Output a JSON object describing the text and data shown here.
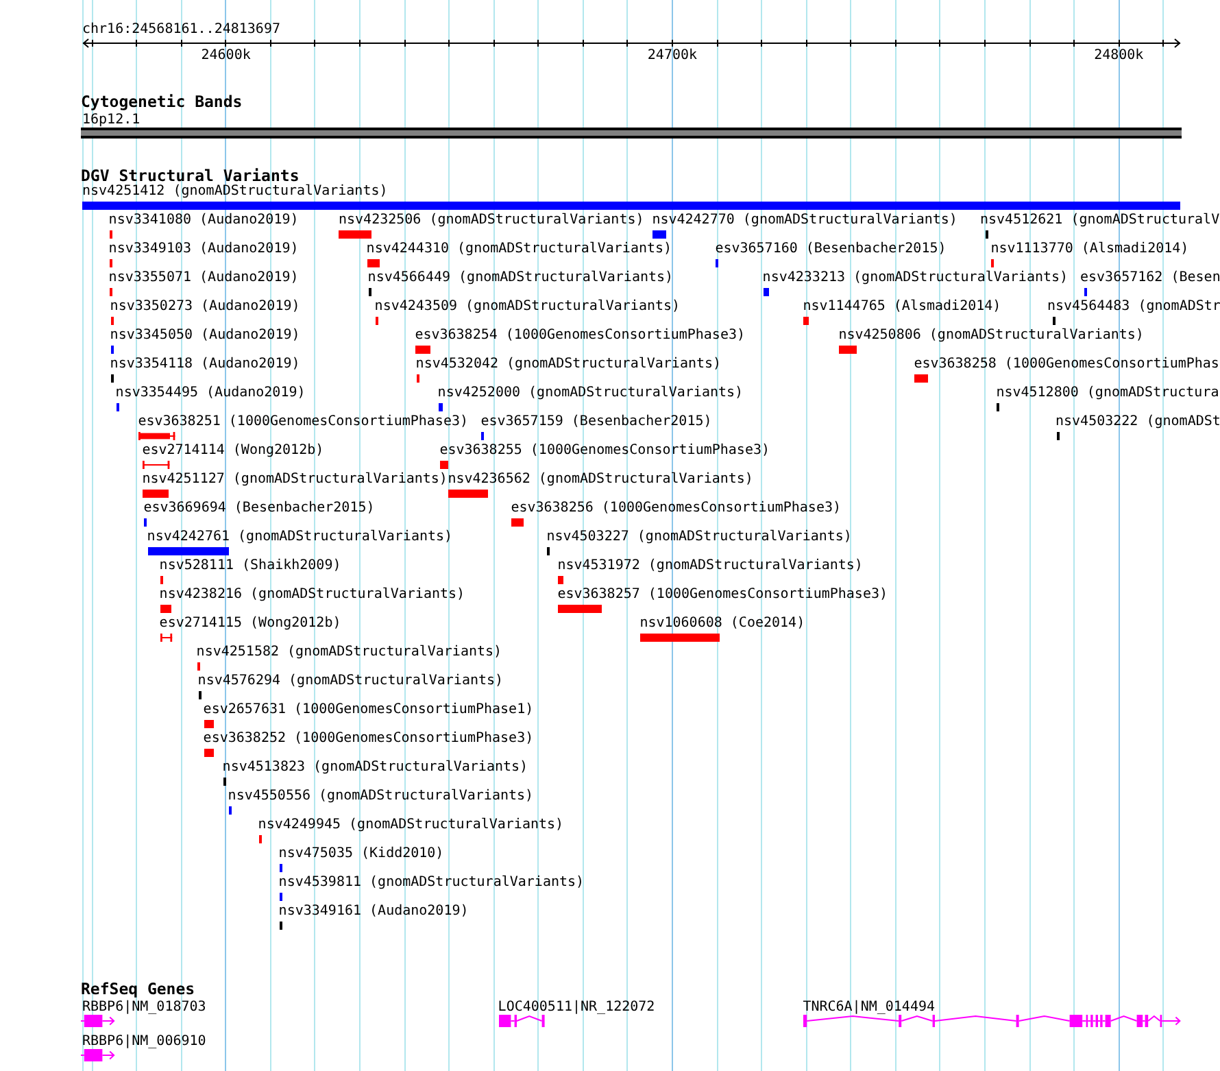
{
  "ruler": {
    "location": "chr16:24568161..24813697",
    "ticks": [
      "24600k",
      "24700k",
      "24800k"
    ]
  },
  "tracks": [
    {
      "kind": "cytoband",
      "title": "Cytogenetic Bands",
      "features": [
        {
          "label": "16p12.1"
        }
      ]
    },
    {
      "kind": "variants",
      "title": "DGV Structural Variants",
      "features": [
        {
          "label": "nsv4251412 (gnomADStructuralVariants)",
          "color": "#0000ff",
          "kind": "bar"
        },
        {
          "label": "nsv3341080 (Audano2019)",
          "color": "#ff0000",
          "kind": "bar"
        },
        {
          "label": "nsv4232506 (gnomADStructuralVariants)",
          "color": "#ff0000",
          "kind": "bar"
        },
        {
          "label": "nsv4242770 (gnomADStructuralVariants)",
          "color": "#0000ff",
          "kind": "bar"
        },
        {
          "label": "nsv4512621 (gnomADStructuralV",
          "color": "#000000",
          "kind": "bar"
        },
        {
          "label": "nsv3349103 (Audano2019)",
          "color": "#ff0000",
          "kind": "bar"
        },
        {
          "label": "nsv4244310 (gnomADStructuralVariants)",
          "color": "#ff0000",
          "kind": "bar"
        },
        {
          "label": "esv3657160 (Besenbacher2015)",
          "color": "#0000ff",
          "kind": "bar"
        },
        {
          "label": "nsv1113770 (Alsmadi2014)",
          "color": "#ff0000",
          "kind": "bar"
        },
        {
          "label": "nsv3355071 (Audano2019)",
          "color": "#ff0000",
          "kind": "bar"
        },
        {
          "label": "nsv4566449 (gnomADStructuralVariants)",
          "color": "#000000",
          "kind": "bar"
        },
        {
          "label": "nsv4233213 (gnomADStructuralVariants)",
          "color": "#0000ff",
          "kind": "bar"
        },
        {
          "label": "esv3657162 (Besen",
          "color": "#0000ff",
          "kind": "bar"
        },
        {
          "label": "nsv3350273 (Audano2019)",
          "color": "#ff0000",
          "kind": "bar"
        },
        {
          "label": "nsv4243509 (gnomADStructuralVariants)",
          "color": "#ff0000",
          "kind": "bar"
        },
        {
          "label": "nsv1144765 (Alsmadi2014)",
          "color": "#ff0000",
          "kind": "bar"
        },
        {
          "label": "nsv4564483 (gnomADStr",
          "color": "#000000",
          "kind": "bar"
        },
        {
          "label": "nsv3345050 (Audano2019)",
          "color": "#0000ff",
          "kind": "bar"
        },
        {
          "label": "esv3638254 (1000GenomesConsortiumPhase3)",
          "color": "#ff0000",
          "kind": "bar"
        },
        {
          "label": "nsv4250806 (gnomADStructuralVariants)",
          "color": "#ff0000",
          "kind": "bar"
        },
        {
          "label": "nsv3354118 (Audano2019)",
          "color": "#000000",
          "kind": "bar"
        },
        {
          "label": "nsv4532042 (gnomADStructuralVariants)",
          "color": "#ff0000",
          "kind": "bar"
        },
        {
          "label": "esv3638258 (1000GenomesConsortiumPhas",
          "color": "#ff0000",
          "kind": "bar"
        },
        {
          "label": "nsv3354495 (Audano2019)",
          "color": "#0000ff",
          "kind": "bar"
        },
        {
          "label": "nsv4252000 (gnomADStructuralVariants)",
          "color": "#0000ff",
          "kind": "bar"
        },
        {
          "label": "nsv4512800 (gnomADStructura",
          "color": "#000000",
          "kind": "bar"
        },
        {
          "label": "esv3638251 (1000GenomesConsortiumPhase3)",
          "color": "#ff0000",
          "kind": "interval"
        },
        {
          "label": "esv3657159 (Besenbacher2015)",
          "color": "#0000ff",
          "kind": "bar"
        },
        {
          "label": "nsv4503222 (gnomADSt",
          "color": "#000000",
          "kind": "bar"
        },
        {
          "label": "esv2714114 (Wong2012b)",
          "color": "#ff0000",
          "kind": "interval"
        },
        {
          "label": "esv3638255 (1000GenomesConsortiumPhase3)",
          "color": "#ff0000",
          "kind": "bar"
        },
        {
          "label": "nsv4251127 (gnomADStructuralVariants)",
          "color": "#ff0000",
          "kind": "bar"
        },
        {
          "label": "nsv4236562 (gnomADStructuralVariants)",
          "color": "#ff0000",
          "kind": "bar"
        },
        {
          "label": "esv3669694 (Besenbacher2015)",
          "color": "#0000ff",
          "kind": "bar"
        },
        {
          "label": "esv3638256 (1000GenomesConsortiumPhase3)",
          "color": "#ff0000",
          "kind": "bar"
        },
        {
          "label": "nsv4242761 (gnomADStructuralVariants)",
          "color": "#0000ff",
          "kind": "bar"
        },
        {
          "label": "nsv4503227 (gnomADStructuralVariants)",
          "color": "#000000",
          "kind": "bar"
        },
        {
          "label": "nsv528111 (Shaikh2009)",
          "color": "#ff0000",
          "kind": "bar"
        },
        {
          "label": "nsv4531972 (gnomADStructuralVariants)",
          "color": "#ff0000",
          "kind": "bar"
        },
        {
          "label": "nsv4238216 (gnomADStructuralVariants)",
          "color": "#ff0000",
          "kind": "bar"
        },
        {
          "label": "esv3638257 (1000GenomesConsortiumPhase3)",
          "color": "#ff0000",
          "kind": "bar"
        },
        {
          "label": "esv2714115 (Wong2012b)",
          "color": "#ff0000",
          "kind": "interval"
        },
        {
          "label": "nsv1060608 (Coe2014)",
          "color": "#ff0000",
          "kind": "bar"
        },
        {
          "label": "nsv4251582 (gnomADStructuralVariants)",
          "color": "#ff0000",
          "kind": "bar"
        },
        {
          "label": "nsv4576294 (gnomADStructuralVariants)",
          "color": "#000000",
          "kind": "bar"
        },
        {
          "label": "esv2657631 (1000GenomesConsortiumPhase1)",
          "color": "#ff0000",
          "kind": "bar"
        },
        {
          "label": "esv3638252 (1000GenomesConsortiumPhase3)",
          "color": "#ff0000",
          "kind": "bar"
        },
        {
          "label": "nsv4513823 (gnomADStructuralVariants)",
          "color": "#000000",
          "kind": "bar"
        },
        {
          "label": "nsv4550556 (gnomADStructuralVariants)",
          "color": "#0000ff",
          "kind": "bar"
        },
        {
          "label": "nsv4249945 (gnomADStructuralVariants)",
          "color": "#ff0000",
          "kind": "bar"
        },
        {
          "label": "nsv475035 (Kidd2010)",
          "color": "#0000ff",
          "kind": "bar"
        },
        {
          "label": "nsv4539811 (gnomADStructuralVariants)",
          "color": "#0000ff",
          "kind": "bar"
        },
        {
          "label": "nsv3349161 (Audano2019)",
          "color": "#000000",
          "kind": "bar"
        }
      ]
    },
    {
      "kind": "genes",
      "title": "RefSeq Genes",
      "features": [
        {
          "label": "RBBP6|NM_018703"
        },
        {
          "label": "LOC400511|NR_122072"
        },
        {
          "label": "TNRC6A|NM_014494"
        },
        {
          "label": "RBBP6|NM_006910"
        }
      ]
    }
  ]
}
